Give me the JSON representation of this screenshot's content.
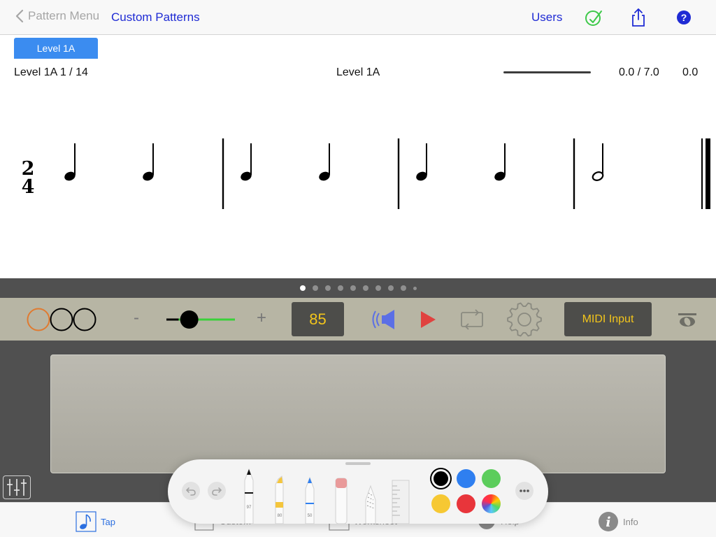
{
  "nav": {
    "back_label": "Pattern Menu",
    "current_label": "Custom Patterns",
    "users_label": "Users"
  },
  "level": {
    "tab_label": "Level 1A",
    "position_text": "Level 1A 1 / 14",
    "center_title": "Level 1A",
    "progress_text": "0.0 / 7.0",
    "score_text": "0.0"
  },
  "notation": {
    "time_signature_top": "2",
    "time_signature_bottom": "4",
    "measures": [
      [
        "quarter",
        "quarter"
      ],
      [
        "quarter",
        "quarter"
      ],
      [
        "quarter",
        "quarter"
      ],
      [
        "half"
      ]
    ]
  },
  "pager": {
    "page_count": 10,
    "current_page": 1
  },
  "transport": {
    "minus_label": "-",
    "plus_label": "+",
    "tempo_value": "85",
    "midi_label": "MIDI Input",
    "count_in_circles": 3,
    "volume_level": 0.18
  },
  "palette": {
    "tools": [
      {
        "name": "pen",
        "number": "97"
      },
      {
        "name": "marker",
        "number": "80"
      },
      {
        "name": "pencil",
        "number": "50"
      },
      {
        "name": "eraser",
        "number": ""
      },
      {
        "name": "lasso",
        "number": ""
      },
      {
        "name": "ruler",
        "number": ""
      }
    ],
    "colors": [
      "#000000",
      "#2f7ff0",
      "#5ccd5c",
      "#f6c833",
      "#e8353b",
      "multicolor"
    ]
  },
  "tabbar": {
    "tabs": [
      {
        "label": "Tap"
      },
      {
        "label": "Custom"
      },
      {
        "label": "Worksheet"
      },
      {
        "label": "Help"
      },
      {
        "label": "Info"
      }
    ]
  },
  "colors": {
    "accent": "#1f2bd4",
    "tab_blue": "#3b8cf0",
    "tempo_text": "#f3c51b",
    "play_red": "#e0423f",
    "slider_green": "#3ad13a"
  }
}
